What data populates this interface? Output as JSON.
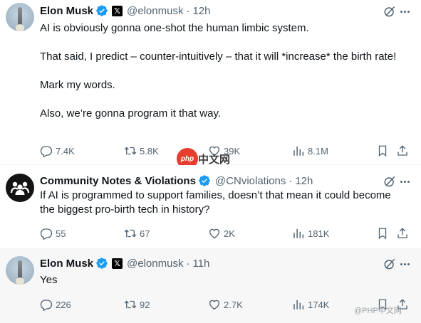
{
  "posts": [
    {
      "author": "Elon Musk",
      "handle": "@elonmusk",
      "separator": "·",
      "time": "12h",
      "has_x_badge": true,
      "paragraphs": [
        "AI is obviously gonna one-shot the human limbic system.",
        "That said, I predict – counter-intuitively – that it will *increase* the birth rate!",
        "Mark my words.",
        "Also, we’re gonna program it that way."
      ],
      "stats": {
        "replies": "7.4K",
        "reposts": "5.8K",
        "likes": "39K",
        "views": "8.1M"
      }
    },
    {
      "author": "Community Notes & Violations",
      "handle": "@CNviolations",
      "separator": "·",
      "time": "12h",
      "has_x_badge": false,
      "paragraphs": [
        "If AI is programmed to support families, doesn’t that mean it could become the biggest pro-birth tech in history?"
      ],
      "stats": {
        "replies": "55",
        "reposts": "67",
        "likes": "2K",
        "views": "181K"
      }
    },
    {
      "author": "Elon Musk",
      "handle": "@elonmusk",
      "separator": "·",
      "time": "11h",
      "has_x_badge": true,
      "paragraphs": [
        "Yes"
      ],
      "stats": {
        "replies": "226",
        "reposts": "92",
        "likes": "2.7K",
        "views": "174K"
      }
    }
  ],
  "badges": {
    "x_badge_glyph": "𝕏"
  },
  "watermarks": {
    "php_logo": "php",
    "cn_text": "中文网",
    "weibo": "@PHP中文网"
  },
  "colors": {
    "verified_blue": "#1d9bf0",
    "secondary_text": "#536471",
    "primary_text": "#0f1419"
  },
  "icons": [
    "verified-icon",
    "x-badge-icon",
    "grok-icon",
    "more-icon",
    "reply-icon",
    "repost-icon",
    "like-icon",
    "views-icon",
    "bookmark-icon",
    "share-icon"
  ]
}
